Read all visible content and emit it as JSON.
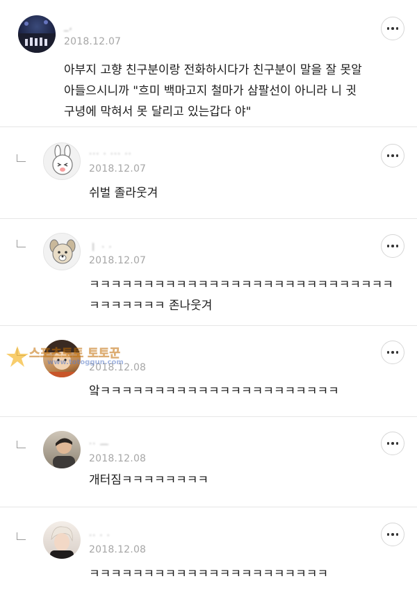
{
  "comments": [
    {
      "author": "_,",
      "date": "2018.12.07",
      "text": "아부지 고향 친구분이랑 전화하시다가 친구분이 말을 잘 못알\n아들으시니까 \"흐미 백마고지 철마가 삼팔선이 아니라 니 귓\n구녕에 막혀서 못 달리고 있는갑다 야\"",
      "avatar_icon": "concert-photo-avatar"
    },
    {
      "author": "··· · ··· ··",
      "date": "2018.12.07",
      "text": "쉬벌 졸라웃겨",
      "avatar_icon": "bunny-cartoon-avatar"
    },
    {
      "author": "ㅣ · ·",
      "date": "2018.12.07",
      "text": "ㅋㅋㅋㅋㅋㅋㅋㅋㅋㅋㅋㅋㅋㅋㅋㅋㅋㅋㅋㅋㅋㅋㅋㅋㅋㅋㅋㅋ\nㅋㅋㅋㅋㅋㅋㅋ 존나웃겨",
      "avatar_icon": "dog-cartoon-avatar"
    },
    {
      "author": "",
      "date": "2018.12.08",
      "text": "앜ㅋㅋㅋㅋㅋㅋㅋㅋㅋㅋㅋㅋㅋㅋㅋㅋㅋㅋㅋㅋㅋㅋ",
      "avatar_icon": "character-avatar"
    },
    {
      "author": "·· —",
      "date": "2018.12.08",
      "text": "개터짐ㅋㅋㅋㅋㅋㅋㅋㅋ",
      "avatar_icon": "person-photo-avatar"
    },
    {
      "author": "·· · ·",
      "date": "2018.12.08",
      "text": "ㅋㅋㅋㅋㅋㅋㅋㅋㅋㅋㅋㅋㅋㅋㅋㅋㅋㅋㅋㅋㅋㅋ",
      "avatar_icon": "person-photo-avatar-2"
    }
  ],
  "watermark": {
    "main": "스포츠토토 토토꾼",
    "url": "www.totoggun.com"
  },
  "colors": {
    "divider": "#e6e6e6",
    "date": "#a6a6a6",
    "text": "#1a1a1a",
    "watermark": "#f2a71b"
  },
  "icons": {
    "more": "more-horizontal-icon",
    "reply": "reply-arrow-icon"
  }
}
